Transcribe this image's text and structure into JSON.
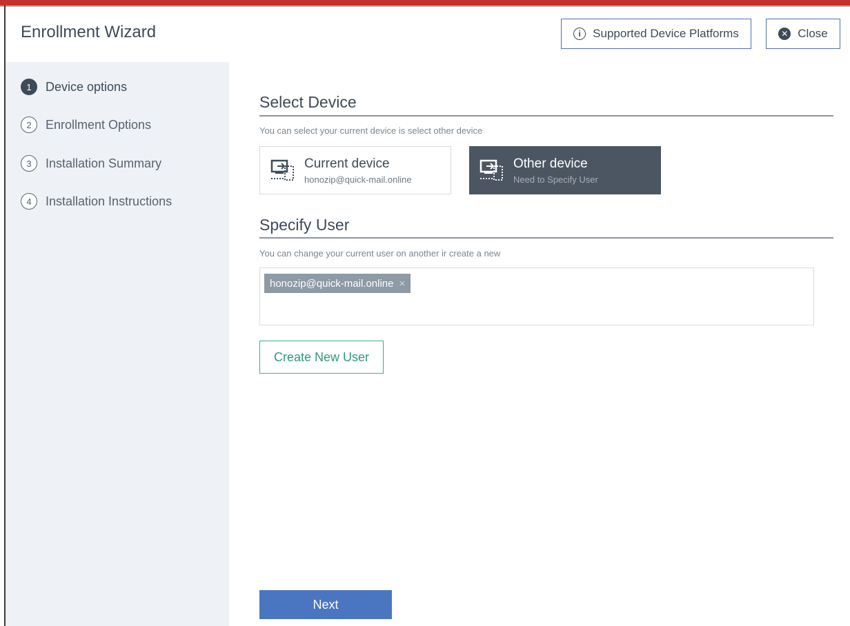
{
  "header": {
    "title": "Enrollment Wizard",
    "platforms_label": "Supported Device Platforms",
    "close_label": "Close"
  },
  "steps": [
    {
      "number": "1",
      "label": "Device options",
      "active": true
    },
    {
      "number": "2",
      "label": "Enrollment Options",
      "active": false
    },
    {
      "number": "3",
      "label": "Installation Summary",
      "active": false
    },
    {
      "number": "4",
      "label": "Installation Instructions",
      "active": false
    }
  ],
  "select_device": {
    "title": "Select Device",
    "description": "You can select your current device is select other device",
    "options": [
      {
        "name": "Current device",
        "sub": "honozip@quick-mail.online",
        "selected": false
      },
      {
        "name": "Other device",
        "sub": "Need to Specify User",
        "selected": true
      }
    ]
  },
  "specify_user": {
    "title": "Specify User",
    "description": "You can change your current user on another ir create a new",
    "selected_user": "honozip@quick-mail.online",
    "remove_glyph": "×"
  },
  "actions": {
    "create_user_label": "Create New User",
    "next_label": "Next"
  },
  "icons": {
    "info": "info-icon",
    "close": "close-icon",
    "device": "device-enroll-icon"
  },
  "colors": {
    "accent": "#4a76c1",
    "create_button": "#3aaf8e",
    "selected_card": "#4c5662",
    "top_strip": "#c9302c"
  }
}
